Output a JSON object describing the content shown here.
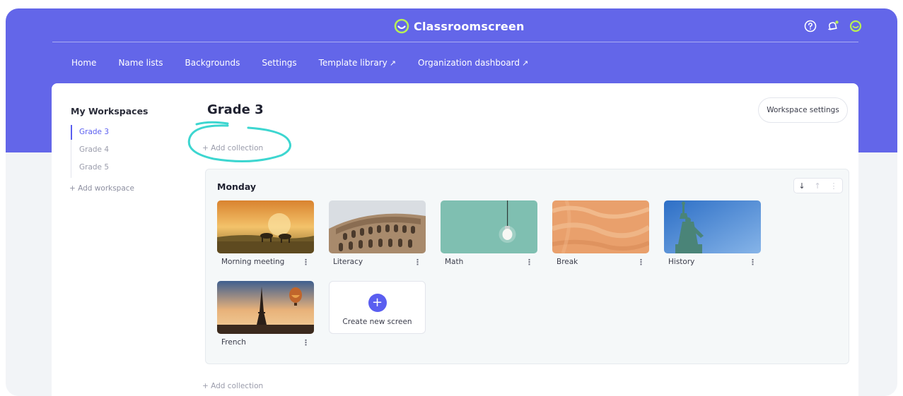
{
  "header": {
    "app_name": "Classroomscreen",
    "brand_color": "#6366e9",
    "accent_color": "#5a5ef0",
    "logo_color": "#b8f055",
    "icons": [
      "help-circle-icon",
      "bell-icon",
      "classroomscreen-logo-icon"
    ]
  },
  "nav": {
    "home": "Home",
    "name_lists": "Name lists",
    "backgrounds": "Backgrounds",
    "settings": "Settings",
    "template_library": "Template library",
    "organization_dashboard": "Organization dashboard",
    "external_arrow": "↗"
  },
  "sidebar": {
    "title": "My Workspaces",
    "items": [
      {
        "label": "Grade 3",
        "active": true
      },
      {
        "label": "Grade 4",
        "active": false
      },
      {
        "label": "Grade 5",
        "active": false
      }
    ],
    "add_label": "+ Add workspace"
  },
  "workspace": {
    "title": "Grade 3",
    "settings_label": "Workspace settings",
    "add_collection_label": "+ Add collection",
    "add_collection_bottom_label": "+ Add collection"
  },
  "collection": {
    "title": "Monday",
    "controls": [
      "arrow-down-icon",
      "arrow-up-icon",
      "more-vertical-icon"
    ],
    "screens": [
      {
        "label": "Morning meeting",
        "image": "horses-sunrise"
      },
      {
        "label": "Literacy",
        "image": "colosseum"
      },
      {
        "label": "Math",
        "image": "lightbulb"
      },
      {
        "label": "Break",
        "image": "sand-texture"
      },
      {
        "label": "History",
        "image": "statue-of-liberty"
      },
      {
        "label": "French",
        "image": "eiffel-tower-balloon"
      }
    ],
    "create_label": "Create new screen",
    "plus": "+"
  }
}
